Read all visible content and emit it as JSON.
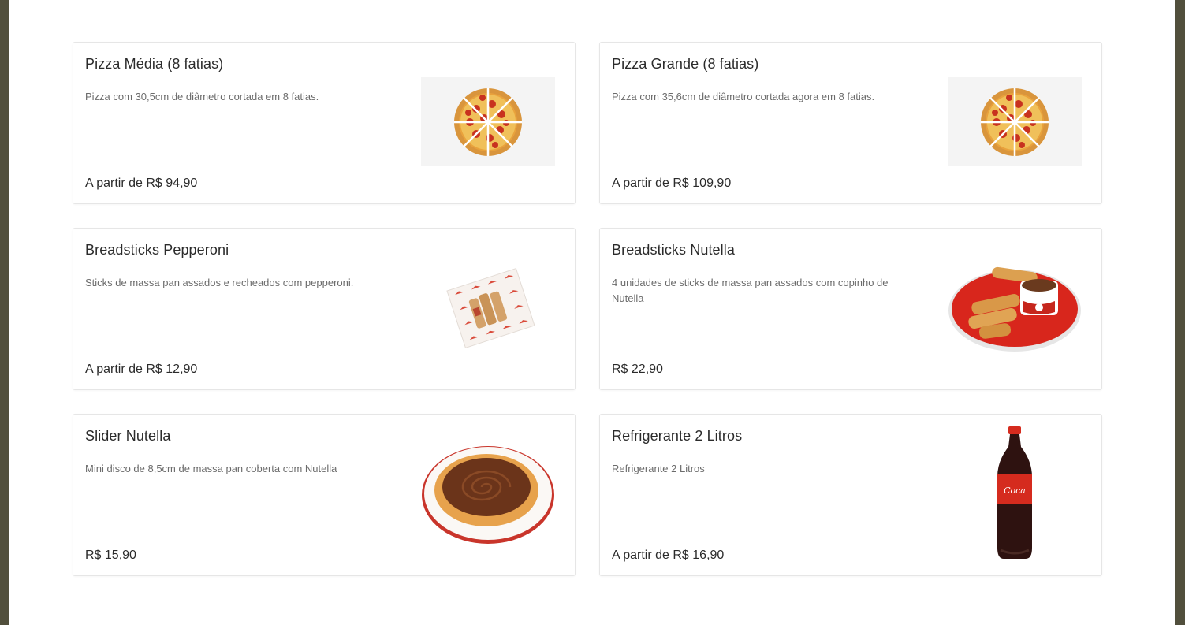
{
  "products": [
    {
      "title": "Pizza Média (8 fatias)",
      "description": "Pizza com 30,5cm de diâmetro cortada em 8 fatias.",
      "price": "A partir de R$ 94,90",
      "image_icon": "pizza-image"
    },
    {
      "title": "Pizza Grande (8 fatias)",
      "description": "Pizza com 35,6cm de diâmetro cortada agora em 8 fatias.",
      "price": "A partir de R$ 109,90",
      "image_icon": "pizza-image"
    },
    {
      "title": "Breadsticks Pepperoni",
      "description": "Sticks de massa pan assados e recheados com pepperoni.",
      "price": "A partir de R$ 12,90",
      "image_icon": "breadsticks-pepperoni-image"
    },
    {
      "title": "Breadsticks Nutella",
      "description": "4 unidades de sticks de massa pan assados com copinho de Nutella",
      "price": "R$ 22,90",
      "image_icon": "breadsticks-nutella-image"
    },
    {
      "title": "Slider Nutella",
      "description": "Mini disco de 8,5cm de massa pan coberta com Nutella",
      "price": "R$ 15,90",
      "image_icon": "slider-nutella-image"
    },
    {
      "title": "Refrigerante 2 Litros",
      "description": "Refrigerante 2 Litros",
      "price": "A partir de R$ 16,90",
      "image_icon": "soda-bottle-image"
    }
  ],
  "colors": {
    "page_bg": "#ffffff",
    "frame_bg": "#514f3c",
    "card_border": "#e6e6e6",
    "title_text": "#2b2b2b",
    "desc_text": "#6b6b6b",
    "accent_red": "#d52b1e"
  }
}
